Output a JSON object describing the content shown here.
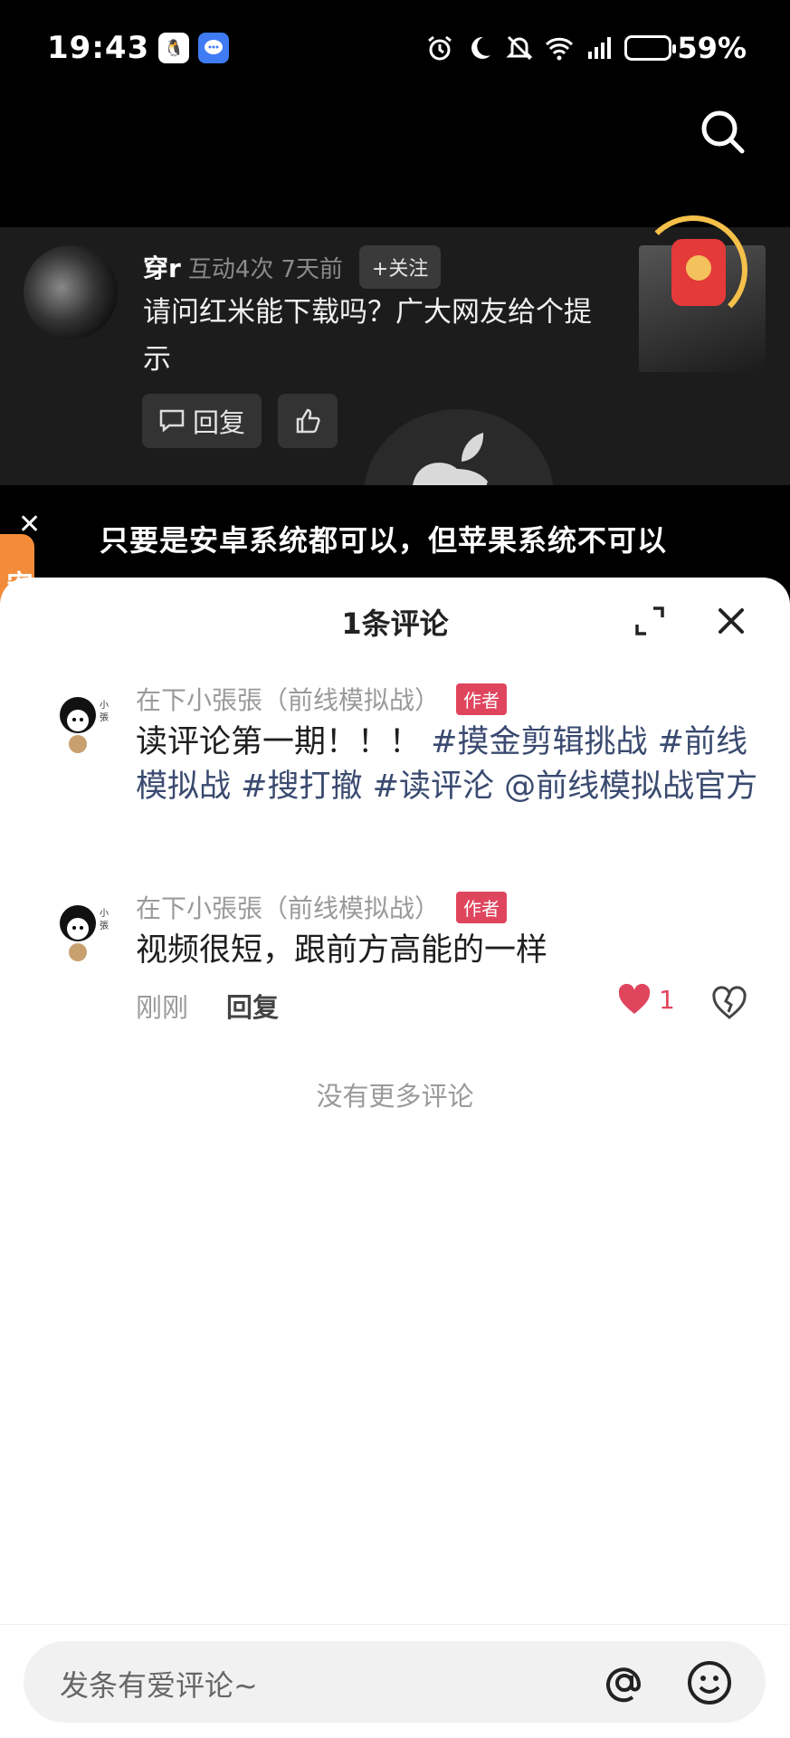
{
  "status": {
    "time": "19:43",
    "battery": "59%"
  },
  "preview_comment": {
    "name": "穿r",
    "interaction": "互动4次",
    "time": "7天前",
    "follow_label": "+关注",
    "text": "请问红米能下载吗？广大网友给个提示",
    "reply_label": "回复"
  },
  "subtitle": "只要是安卓系统都可以，但苹果系统不可以",
  "side_tab": "安线花",
  "sheet": {
    "title": "1条评论",
    "comments": [
      {
        "author": "在下小張張（前线模拟战）",
        "badge": "作者",
        "text_plain": "读评论第一期！！！",
        "tags": [
          "#摸金剪辑挑战",
          "#前线模拟战",
          "#搜打撤",
          "#读评沦",
          "@前线模拟战官方"
        ]
      },
      {
        "author": "在下小張張（前线模拟战）",
        "badge": "作者",
        "text": "视频很短，跟前方高能的一样",
        "time": "刚刚",
        "reply_label": "回复",
        "likes": "1"
      }
    ],
    "no_more": "没有更多评论"
  },
  "input": {
    "placeholder": "发条有爱评论~"
  },
  "colors": {
    "accent_red": "#e0455e",
    "tag_blue": "#3a4a70"
  }
}
